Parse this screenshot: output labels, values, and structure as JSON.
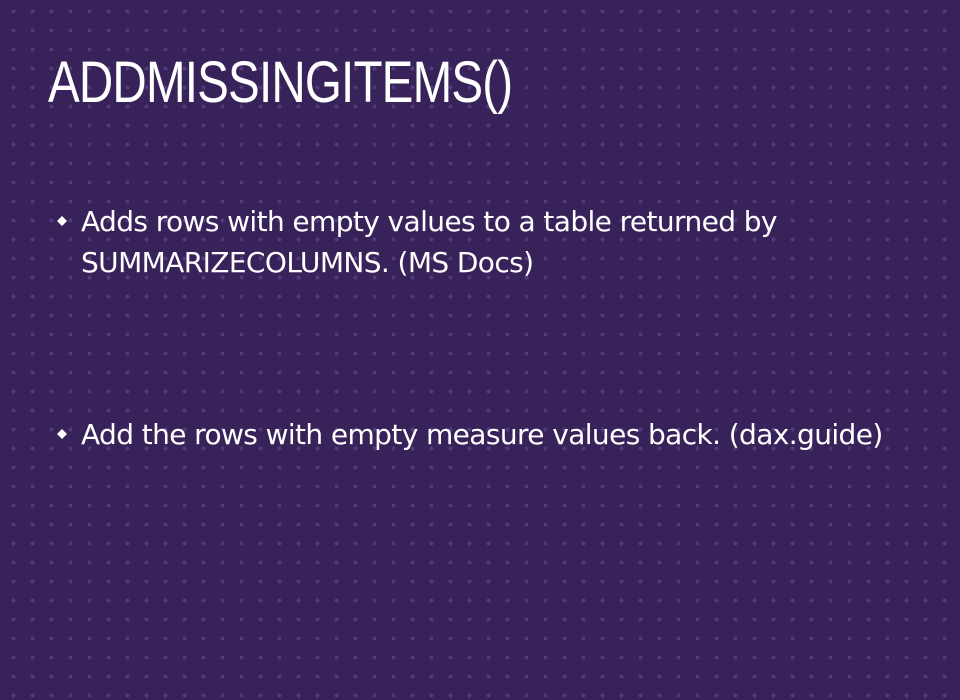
{
  "slide": {
    "title": "ADDMISSINGITEMS()",
    "bullets": [
      {
        "icon": "diamond-bullet-icon",
        "text": "Adds rows with empty values to a table returned by SUMMARIZECOLUMNS. (MS Docs)"
      },
      {
        "icon": "diamond-bullet-icon",
        "text": "Add the rows with empty measure values back. (dax.guide)"
      }
    ]
  },
  "colors": {
    "background": "#37235a",
    "dot_pattern": "#8c6ebe",
    "text": "#ffffff"
  }
}
